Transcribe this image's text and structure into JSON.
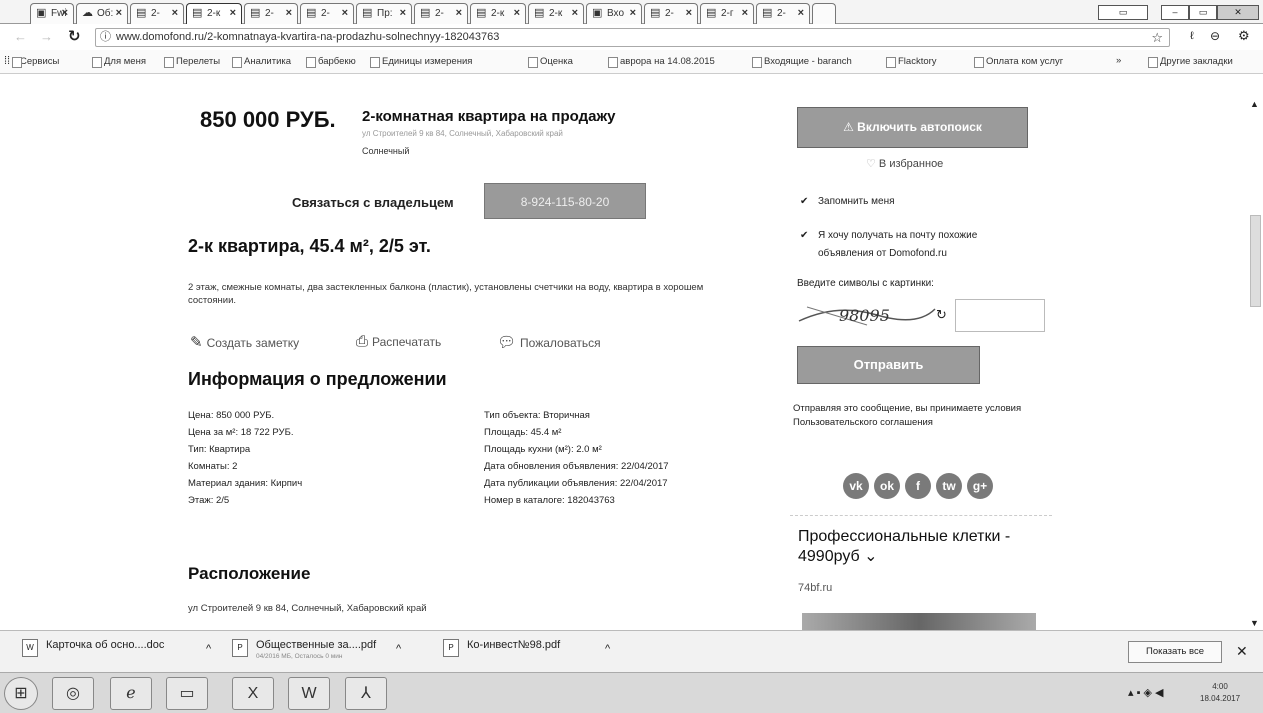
{
  "tabs": [
    {
      "icon": "▣",
      "label": "Fwi"
    },
    {
      "icon": "☁",
      "label": "Об:"
    },
    {
      "icon": "▤",
      "label": "2-"
    },
    {
      "icon": "▤",
      "label": "2-к"
    },
    {
      "icon": "▤",
      "label": "2-"
    },
    {
      "icon": "▤",
      "label": "2-"
    },
    {
      "icon": "▤",
      "label": "Пр:"
    },
    {
      "icon": "▤",
      "label": "2-"
    },
    {
      "icon": "▤",
      "label": "2-к"
    },
    {
      "icon": "▤",
      "label": "2-к"
    },
    {
      "icon": "▣",
      "label": "Вхо"
    },
    {
      "icon": "▤",
      "label": "2-"
    },
    {
      "icon": "▤",
      "label": "2-г"
    },
    {
      "icon": "▤",
      "label": "2-"
    }
  ],
  "address_bar": {
    "url": "www.domofond.ru/2-komnatnaya-kvartira-na-prodazhu-solnechnyy-182043763"
  },
  "bookmarks": [
    "Сервисы",
    "Для меня",
    "Перелеты",
    "Аналитика",
    "барбекю",
    "Единицы измерения",
    "Оценка",
    "аврора на 14.08.2015",
    "Входящие - baranch",
    "Flacktory",
    "Оплата ком услуг",
    "»",
    "Другие закладки"
  ],
  "listing": {
    "price": "850 000 РУБ.",
    "title": "2-комнатная квартира на продажу",
    "address": "ул Строителей 9 кв 84, Солнечный, Хабаровский край",
    "city": "Солнечный",
    "contact_label": "Связаться с владельцем",
    "phone": "8-924-115-80-20",
    "heading": "2-к квартира, 45.4 м², 2/5 эт.",
    "description": "2 этаж, смежные комнаты, два застекленных балкона (пластик), установлены счетчики на воду, квартира в хорошем состоянии.",
    "actions": {
      "note": "Создать заметку",
      "print": "Распечатать",
      "report": "Пожаловаться"
    },
    "info_heading": "Информация о предложении",
    "info_left": [
      "Цена: 850 000 РУБ.",
      "Цена за м²: 18 722 РУБ.",
      "Тип: Квартира",
      "Комнаты: 2",
      "Материал здания: Кирпич",
      "Этаж: 2/5"
    ],
    "info_right": [
      "Тип объекта: Вторичная",
      "Площадь: 45.4 м²",
      "Площадь кухни (м²): 2.0 м²",
      "Дата обновления объявления: 22/04/2017",
      "Дата публикации объявления: 22/04/2017",
      "Номер в каталоге: 182043763"
    ],
    "location_heading": "Расположение",
    "location_text": "ул Строителей 9 кв 84, Солнечный, Хабаровский край"
  },
  "sidebar": {
    "autosearch_button": "Включить автопоиск",
    "favorites": "В избранное",
    "remember_me": "Запомнить меня",
    "similar_line1": "Я хочу получать на почту похожие",
    "similar_line2": "объявления от Domofond.ru",
    "captcha_label": "Введите символы с картинки:",
    "captcha_text": "98095",
    "send_button": "Отправить",
    "agreement": "Отправляя это сообщение, вы принимаете условия Пользовательского соглашения",
    "social": [
      "vk",
      "ok",
      "f",
      "tw",
      "g+"
    ],
    "ad_title": "Профессиональные клетки - 4990руб",
    "ad_domain": "74bf.ru"
  },
  "downloads": [
    {
      "name": "Карточка об осно....doc",
      "sub": ""
    },
    {
      "name": "Общественные за....pdf",
      "sub": "04/2016 МБ, Осталось 0 мин"
    },
    {
      "name": "Ко-инвест№98.pdf",
      "sub": ""
    }
  ],
  "show_all": "Показать все",
  "clock": {
    "time": "4:00",
    "date": "18.04.2017"
  }
}
